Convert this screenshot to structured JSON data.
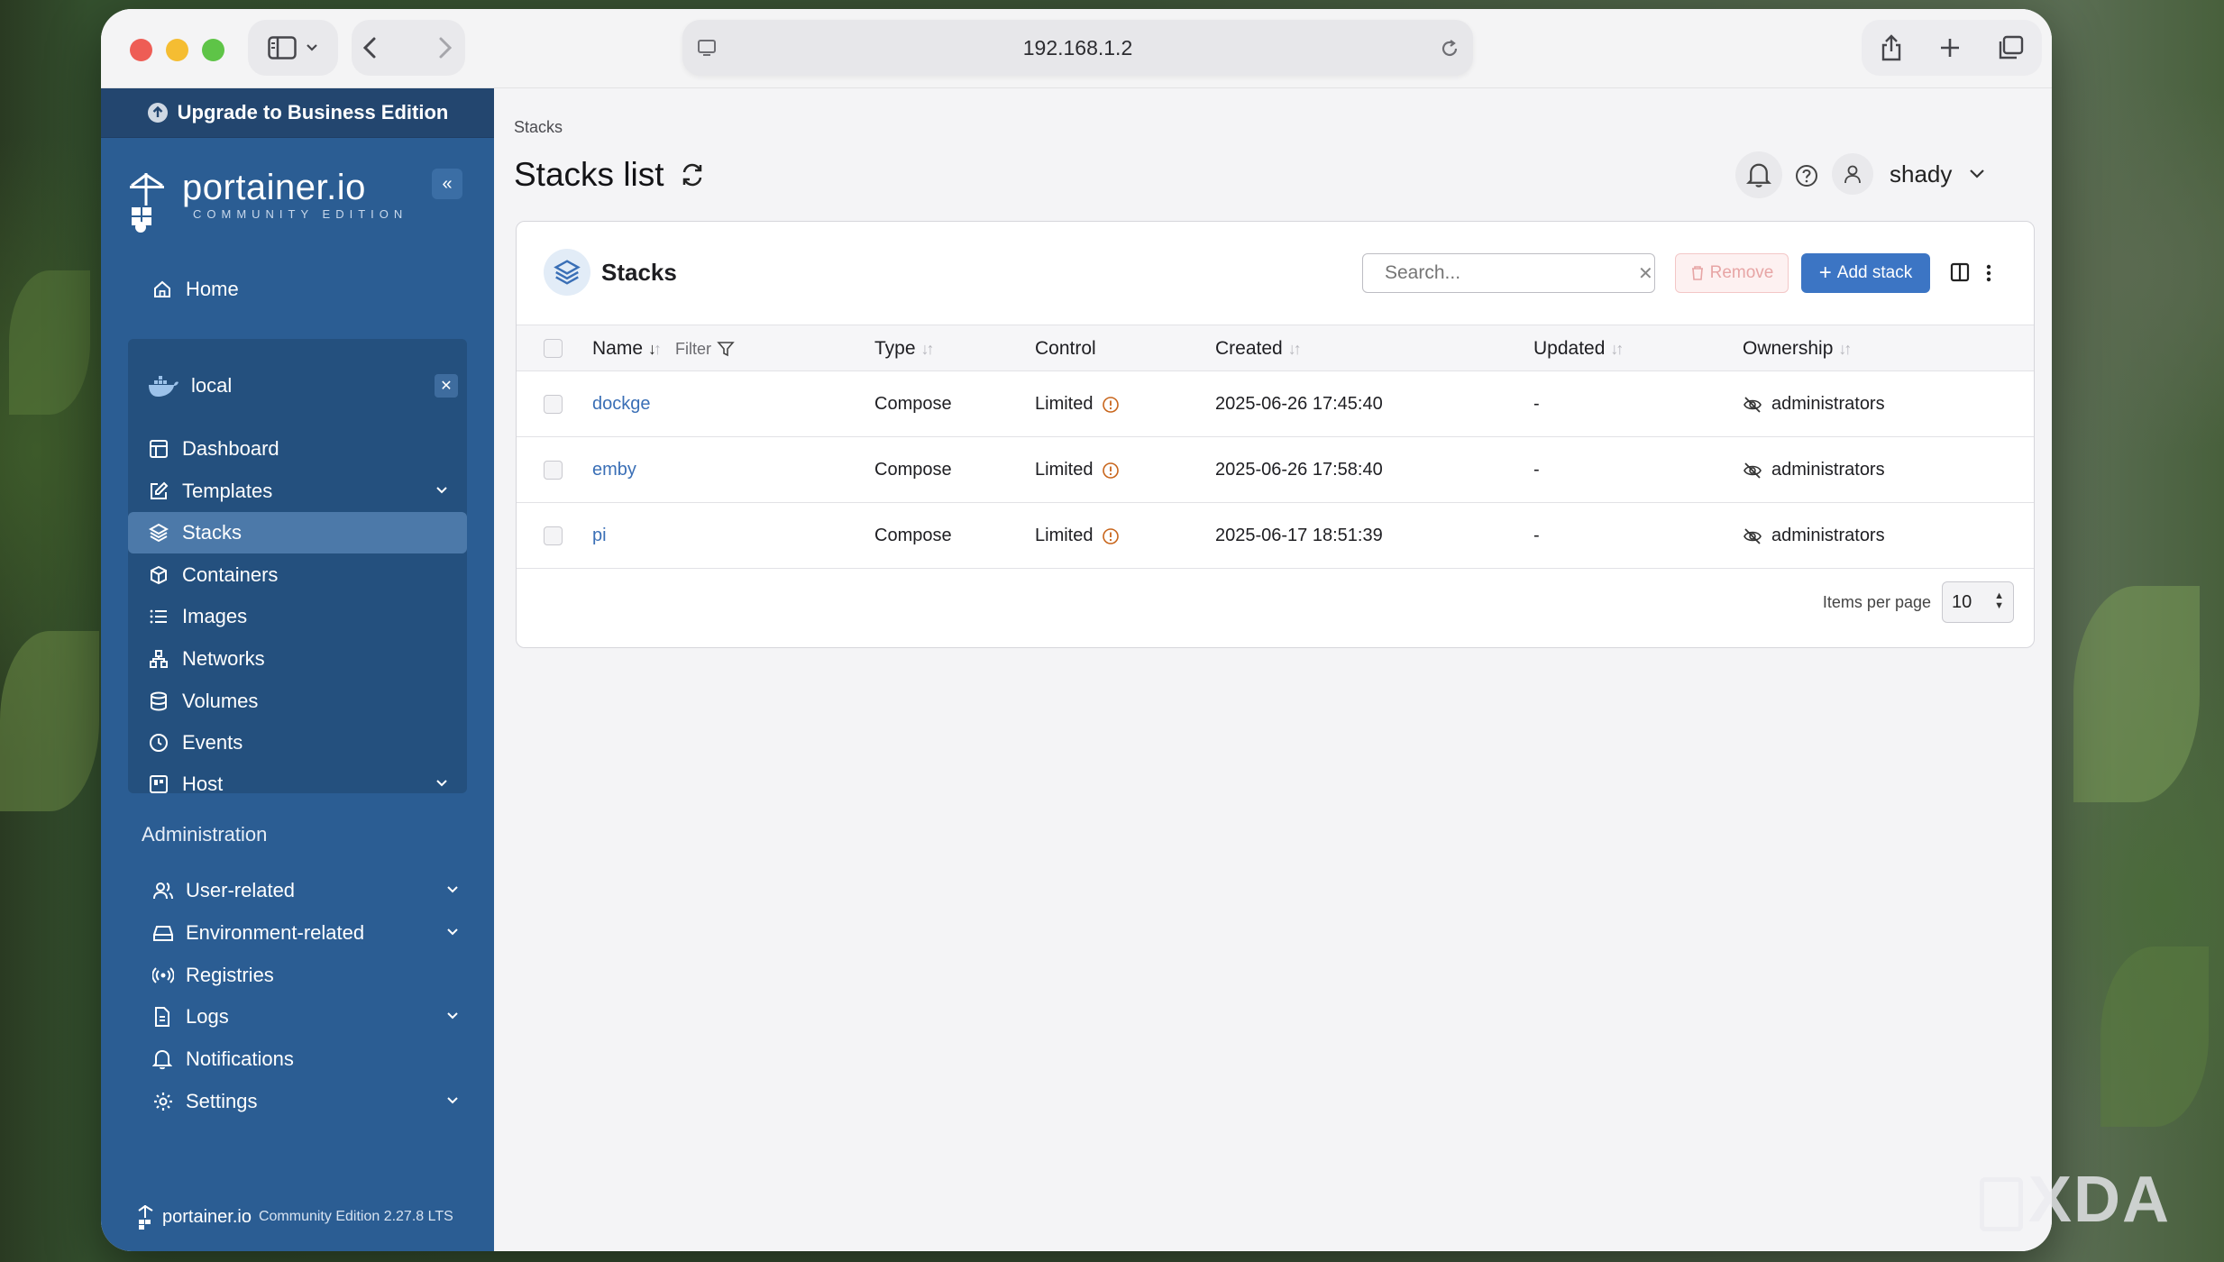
{
  "browser": {
    "url": "192.168.1.2"
  },
  "sidebar": {
    "upgrade_label": "Upgrade to Business Edition",
    "brand_name": "portainer.io",
    "brand_sub": "COMMUNITY EDITION",
    "home_label": "Home",
    "environment_name": "local",
    "env_items": [
      {
        "label": "Dashboard",
        "icon": "dashboard-icon"
      },
      {
        "label": "Templates",
        "icon": "edit-icon",
        "expandable": true
      },
      {
        "label": "Stacks",
        "icon": "layers-icon",
        "active": true
      },
      {
        "label": "Containers",
        "icon": "box-icon"
      },
      {
        "label": "Images",
        "icon": "list-icon"
      },
      {
        "label": "Networks",
        "icon": "network-icon"
      },
      {
        "label": "Volumes",
        "icon": "database-icon"
      },
      {
        "label": "Events",
        "icon": "clock-icon"
      },
      {
        "label": "Host",
        "icon": "host-icon",
        "expandable": true
      }
    ],
    "admin_title": "Administration",
    "admin_items": [
      {
        "label": "User-related",
        "icon": "users-icon",
        "expandable": true
      },
      {
        "label": "Environment-related",
        "icon": "drive-icon",
        "expandable": true
      },
      {
        "label": "Registries",
        "icon": "radio-icon"
      },
      {
        "label": "Logs",
        "icon": "file-icon",
        "expandable": true
      },
      {
        "label": "Notifications",
        "icon": "bell-icon"
      },
      {
        "label": "Settings",
        "icon": "gear-icon",
        "expandable": true
      }
    ],
    "footer_brand": "portainer.io",
    "footer_edition": "Community Edition 2.27.8 LTS"
  },
  "main": {
    "breadcrumb": "Stacks",
    "page_title": "Stacks list",
    "username": "shady",
    "card_title": "Stacks",
    "search_placeholder": "Search...",
    "remove_label": "Remove",
    "add_label": "Add stack",
    "columns": {
      "name": "Name",
      "filter": "Filter",
      "type": "Type",
      "control": "Control",
      "created": "Created",
      "updated": "Updated",
      "ownership": "Ownership"
    },
    "rows": [
      {
        "name": "dockge",
        "type": "Compose",
        "control": "Limited",
        "created": "2025-06-26 17:45:40",
        "updated": "-",
        "ownership": "administrators"
      },
      {
        "name": "emby",
        "type": "Compose",
        "control": "Limited",
        "created": "2025-06-26 17:58:40",
        "updated": "-",
        "ownership": "administrators"
      },
      {
        "name": "pi",
        "type": "Compose",
        "control": "Limited",
        "created": "2025-06-17 18:51:39",
        "updated": "-",
        "ownership": "administrators"
      }
    ],
    "items_per_page_label": "Items per page",
    "items_per_page_value": "10"
  },
  "watermark": "XDA",
  "colors": {
    "sidebar": "#2b5d93",
    "accent": "#3c75c4",
    "link": "#3a6fb6"
  }
}
